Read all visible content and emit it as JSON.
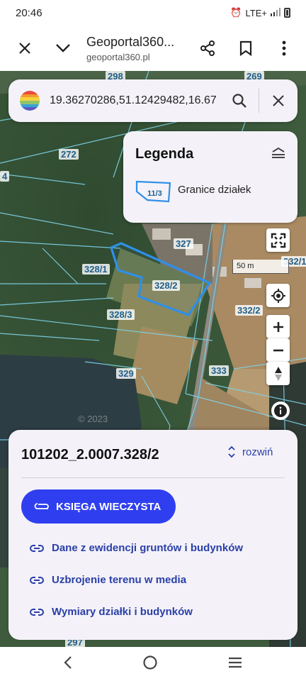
{
  "status_bar": {
    "time": "20:46",
    "network": "LTE+"
  },
  "browser": {
    "title": "Geoportal360...",
    "url": "geoportal360.pl"
  },
  "search": {
    "coords": "19.36270286,51.12429482,16.67"
  },
  "legend": {
    "title": "Legenda",
    "symbol_label": "11/3",
    "item_label": "Granice działek"
  },
  "map": {
    "parcel_labels": [
      "298",
      "269",
      "272",
      "4",
      "327",
      "332/1",
      "328/1",
      "328/2",
      "332/2",
      "328/3",
      "333",
      "329",
      "297"
    ],
    "scale": "50 m",
    "watermark": "© 2023"
  },
  "sheet": {
    "parcel_id": "101202_2.0007.328/2",
    "expand_label": "rozwiń",
    "primary_button": "KSIĘGA WIECZYSTA",
    "links": [
      "Dane z ewidencji gruntów i budynków",
      "Uzbrojenie terenu w media",
      "Wymiary działki i budynków"
    ]
  },
  "colors": {
    "accent": "#2f3ff0",
    "link": "#2a3fa8",
    "parcel_boundary": "#2f8fe8",
    "panel": "#f4f2f8"
  }
}
